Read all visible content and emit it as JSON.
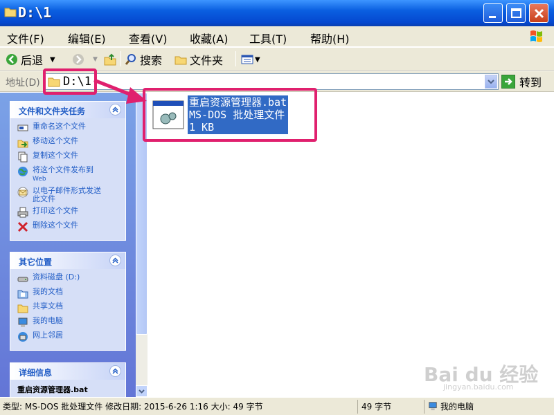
{
  "window": {
    "title": "D:\\1"
  },
  "menu": [
    "文件(F)",
    "编辑(E)",
    "查看(V)",
    "收藏(A)",
    "工具(T)",
    "帮助(H)"
  ],
  "toolbar": {
    "back": "后退",
    "search": "搜索",
    "folders": "文件夹"
  },
  "address": {
    "label": "地址(D)",
    "value": "D:\\1",
    "go": "转到"
  },
  "tasks_panel": {
    "title": "文件和文件夹任务",
    "items": [
      {
        "label": "重命名这个文件",
        "icon": "rename-icon"
      },
      {
        "label": "移动这个文件",
        "icon": "move-icon"
      },
      {
        "label": "复制这个文件",
        "icon": "copy-icon"
      },
      {
        "label": "将这个文件发布到",
        "sub": "Web",
        "icon": "publish-web-icon"
      },
      {
        "label": "以电子邮件形式发送",
        "sub": "此文件",
        "icon": "email-icon"
      },
      {
        "label": "打印这个文件",
        "icon": "print-icon"
      },
      {
        "label": "删除这个文件",
        "icon": "delete-icon"
      }
    ]
  },
  "places_panel": {
    "title": "其它位置",
    "items": [
      {
        "label": "资料磁盘 (D:)",
        "icon": "drive-icon"
      },
      {
        "label": "我的文档",
        "icon": "my-documents-icon"
      },
      {
        "label": "共享文档",
        "icon": "shared-folder-icon"
      },
      {
        "label": "我的电脑",
        "icon": "my-computer-icon"
      },
      {
        "label": "网上邻居",
        "icon": "network-icon"
      }
    ]
  },
  "details_panel": {
    "title": "详细信息",
    "filename": "重启资源管理器.bat"
  },
  "file": {
    "name": "重启资源管理器.bat",
    "type": "MS-DOS 批处理文件",
    "size": "1 KB"
  },
  "status": {
    "info": "类型: MS-DOS 批处理文件 修改日期: 2015-6-26 1:16 大小: 49 字节",
    "size": "49 字节",
    "location": "我的电脑"
  },
  "watermark": {
    "brand": "Bai du 经验",
    "url": "jingyan.baidu.com"
  },
  "colors": {
    "selection": "#316ac5",
    "highlight": "#e0206e",
    "taskpane": "#6375d6"
  }
}
